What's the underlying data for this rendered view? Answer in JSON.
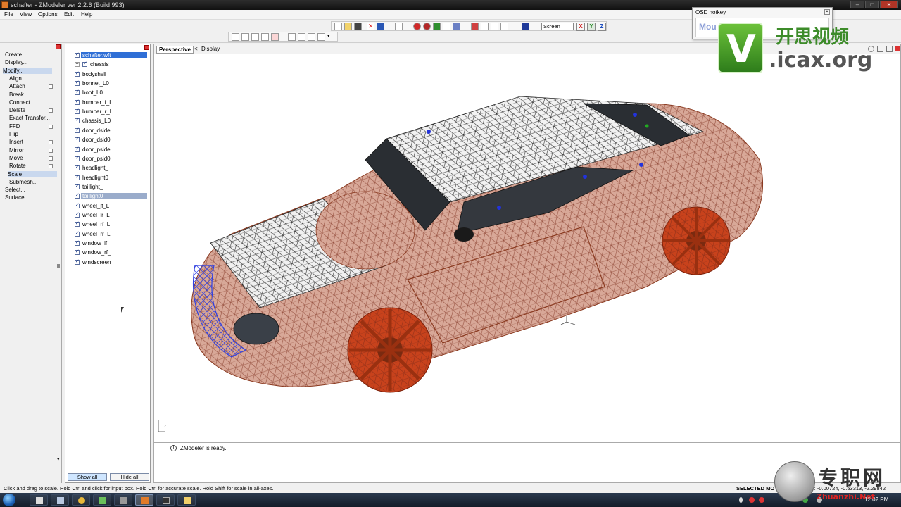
{
  "window": {
    "title": "schafter - ZModeler ver 2.2.6 (Build 993)",
    "controls": {
      "minimize": "–",
      "maximize": "□",
      "close": "✕"
    }
  },
  "menu": [
    "File",
    "View",
    "Options",
    "Edit",
    "Help"
  ],
  "toolbar": {
    "view_mode": "Screen",
    "axes": [
      "X",
      "Y",
      "Z"
    ],
    "axis_colors": {
      "X": "#d02020",
      "Y": "#2a8a2a",
      "Z": "#1f4fbf"
    }
  },
  "command_panel": {
    "items": [
      {
        "label": "Create...",
        "level": 0
      },
      {
        "label": "Display...",
        "level": 0
      },
      {
        "label": "Modify...",
        "level": 0,
        "active": true
      },
      {
        "label": "Align...",
        "level": 1
      },
      {
        "label": "Attach",
        "level": 1,
        "toggle": true
      },
      {
        "label": "Break",
        "level": 1
      },
      {
        "label": "Connect",
        "level": 1
      },
      {
        "label": "Delete",
        "level": 1,
        "toggle": true
      },
      {
        "label": "Exact Transfor...",
        "level": 1
      },
      {
        "label": "FFD",
        "level": 1,
        "toggle": true
      },
      {
        "label": "Flip",
        "level": 1
      },
      {
        "label": "Insert",
        "level": 1,
        "toggle": true
      },
      {
        "label": "Mirror",
        "level": 1,
        "toggle": true
      },
      {
        "label": "Move",
        "level": 1,
        "toggle": true
      },
      {
        "label": "Rotate",
        "level": 1,
        "toggle": true
      },
      {
        "label": "Scale",
        "level": 1,
        "active": true
      },
      {
        "label": "Submesh...",
        "level": 1
      },
      {
        "label": "Select...",
        "level": 0
      },
      {
        "label": "Surface...",
        "level": 0
      }
    ]
  },
  "object_tree": {
    "root": "schafter.wft",
    "items": [
      "chassis",
      "bodyshell_",
      "bonnet_L0",
      "boot_L0",
      "bumper_f_L",
      "bumper_r_L",
      "chassis_L0",
      "door_dside",
      "door_dsid0",
      "door_pside",
      "door_psid0",
      "headlight_",
      "headlight0",
      "taillight_",
      "taillight0",
      "wheel_lf_L",
      "wheel_lr_L",
      "wheel_rf_L",
      "wheel_rr_L",
      "window_lf_",
      "window_rf_",
      "windscreen"
    ],
    "highlighted": "taillight0",
    "show_all_label": "Show all",
    "hide_all_label": "Hide all"
  },
  "viewport": {
    "tabs": [
      "Perspective",
      "<",
      "Display"
    ],
    "body_color": "#c06a50",
    "selection_color": "#3040e0"
  },
  "status_log": {
    "message": "ZModeler is ready."
  },
  "hint_bar": {
    "hint": "Click and drag to scale. Hold Ctrl and click for input box. Hold Ctrl for accurate scale. Hold Shift for scale in all-axes.",
    "mode": "SELECTED MO",
    "coords": "or: -0.00724, -0.53313, -2.29842"
  },
  "osd": {
    "title": "OSD hotkey",
    "text": "Mou"
  },
  "taskbar": {
    "clock": "12:02 PM"
  },
  "watermark_top": {
    "letter": "V",
    "cn": "开思视频",
    "site": ".icax.org"
  },
  "watermark_bottom": {
    "cn": "专职网",
    "site": "Zhuanzhi.Net"
  }
}
